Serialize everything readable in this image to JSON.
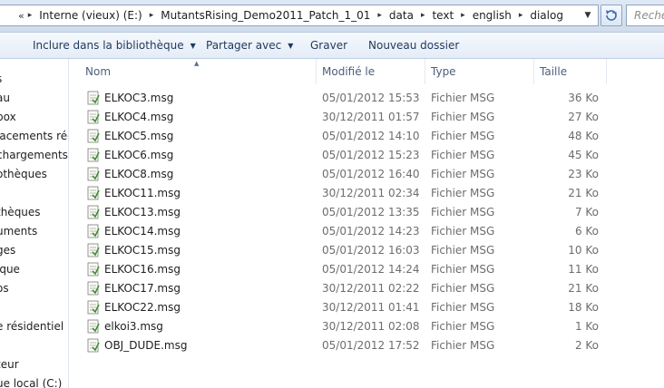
{
  "address": {
    "overflow_glyph": "«",
    "crumbs": [
      "Interne (vieux) (E:)",
      "MutantsRising_Demo2011_Patch_1_01",
      "data",
      "text",
      "english",
      "dialog"
    ],
    "separator_glyph": "▸",
    "dropdown_glyph": "▼"
  },
  "search": {
    "placeholder": "Reche"
  },
  "toolbar": {
    "include": "Inclure dans la bibliothèque",
    "share": "Partager avec",
    "burn": "Graver",
    "new_folder": "Nouveau dossier",
    "arrow_glyph": "▼"
  },
  "nav": {
    "items": [
      "s",
      "au",
      "box",
      "lacements réc",
      "chargements",
      "othèques",
      "thèques",
      "uments",
      "ges",
      "ique",
      "os",
      "e résidentiel",
      "teur",
      "ue local (C:)"
    ]
  },
  "columns": {
    "name": "Nom",
    "modified": "Modifié le",
    "type": "Type",
    "size": "Taille",
    "sort_glyph": "▲"
  },
  "files": [
    {
      "name": "ELKOC3.msg",
      "modified": "05/01/2012 15:53",
      "type": "Fichier MSG",
      "size": "36 Ko"
    },
    {
      "name": "ELKOC4.msg",
      "modified": "30/12/2011 01:57",
      "type": "Fichier MSG",
      "size": "27 Ko"
    },
    {
      "name": "ELKOC5.msg",
      "modified": "05/01/2012 14:10",
      "type": "Fichier MSG",
      "size": "48 Ko"
    },
    {
      "name": "ELKOC6.msg",
      "modified": "05/01/2012 15:23",
      "type": "Fichier MSG",
      "size": "45 Ko"
    },
    {
      "name": "ELKOC8.msg",
      "modified": "05/01/2012 16:40",
      "type": "Fichier MSG",
      "size": "23 Ko"
    },
    {
      "name": "ELKOC11.msg",
      "modified": "30/12/2011 02:34",
      "type": "Fichier MSG",
      "size": "21 Ko"
    },
    {
      "name": "ELKOC13.msg",
      "modified": "05/01/2012 13:35",
      "type": "Fichier MSG",
      "size": "7 Ko"
    },
    {
      "name": "ELKOC14.msg",
      "modified": "05/01/2012 14:23",
      "type": "Fichier MSG",
      "size": "6 Ko"
    },
    {
      "name": "ELKOC15.msg",
      "modified": "05/01/2012 16:03",
      "type": "Fichier MSG",
      "size": "10 Ko"
    },
    {
      "name": "ELKOC16.msg",
      "modified": "05/01/2012 14:24",
      "type": "Fichier MSG",
      "size": "11 Ko"
    },
    {
      "name": "ELKOC17.msg",
      "modified": "30/12/2011 02:22",
      "type": "Fichier MSG",
      "size": "21 Ko"
    },
    {
      "name": "ELKOC22.msg",
      "modified": "30/12/2011 01:41",
      "type": "Fichier MSG",
      "size": "18 Ko"
    },
    {
      "name": "elkoi3.msg",
      "modified": "30/12/2011 02:08",
      "type": "Fichier MSG",
      "size": "1 Ko"
    },
    {
      "name": "OBJ_DUDE.msg",
      "modified": "05/01/2012 17:52",
      "type": "Fichier MSG",
      "size": "2 Ko"
    }
  ],
  "icons": {
    "address_folder": "folder-icon",
    "refresh": "refresh-icon",
    "file": "msg-file-icon"
  },
  "colors": {
    "toolbar_text": "#1e395b",
    "header_text": "#4c607a",
    "detail_text": "#6d6d6d",
    "icon_green": "#3f8f2f"
  }
}
